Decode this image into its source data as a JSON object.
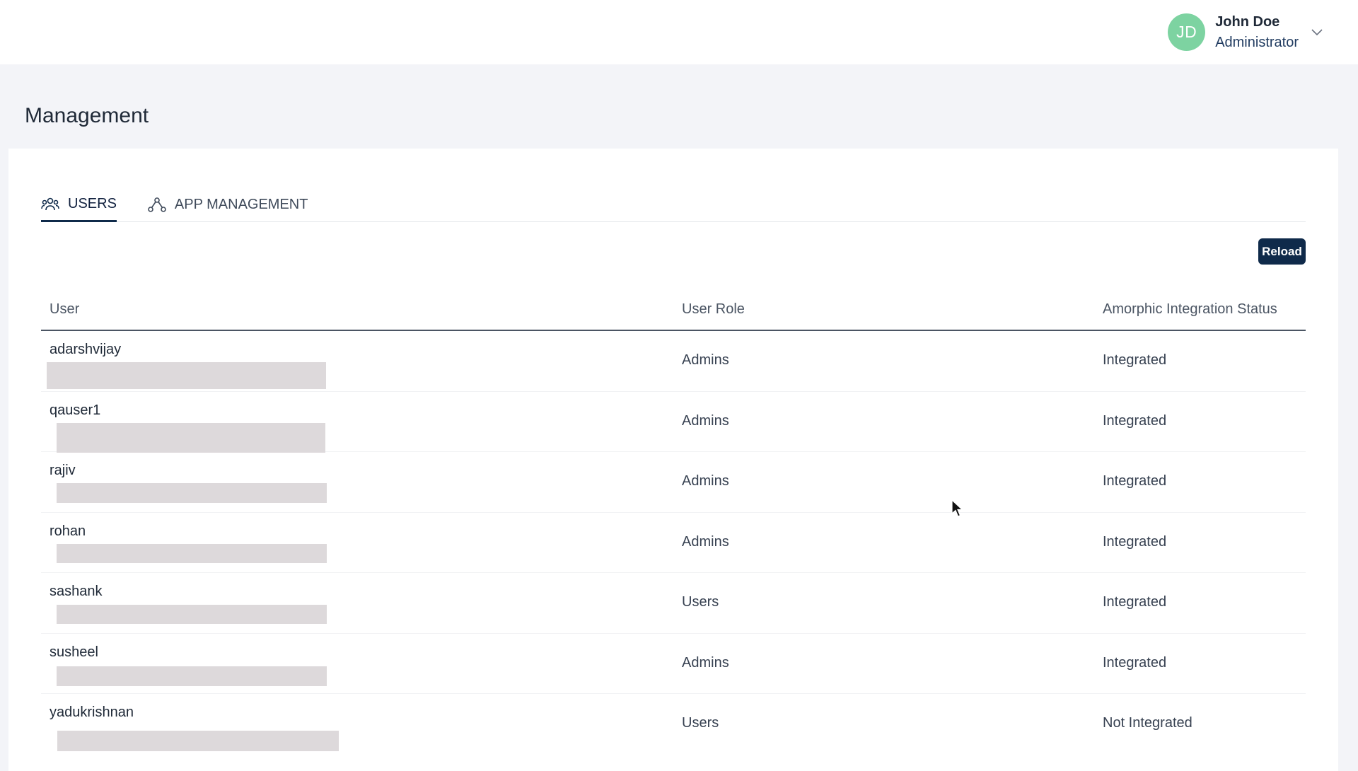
{
  "header": {
    "user": {
      "initials": "JD",
      "name": "John Doe",
      "role": "Administrator"
    }
  },
  "page": {
    "title": "Management"
  },
  "tabs": [
    {
      "label": "USERS",
      "icon": "users-icon",
      "active": true
    },
    {
      "label": "APP MANAGEMENT",
      "icon": "app-management-icon",
      "active": false
    }
  ],
  "toolbar": {
    "reload_label": "Reload"
  },
  "table": {
    "columns": [
      "User",
      "User Role",
      "Amorphic Integration Status"
    ],
    "rows": [
      {
        "user": "adarshvijay",
        "role": "Admins",
        "status": "Integrated"
      },
      {
        "user": "qauser1",
        "role": "Admins",
        "status": "Integrated"
      },
      {
        "user": "rajiv",
        "role": "Admins",
        "status": "Integrated"
      },
      {
        "user": "rohan",
        "role": "Admins",
        "status": "Integrated"
      },
      {
        "user": "sashank",
        "role": "Users",
        "status": "Integrated"
      },
      {
        "user": "susheel",
        "role": "Admins",
        "status": "Integrated"
      },
      {
        "user": "yadukrishnan",
        "role": "Users",
        "status": "Not Integrated"
      }
    ]
  },
  "colors": {
    "accent": "#0f2a4a",
    "avatar": "#7dd3a1",
    "redaction": "#ddd9db"
  }
}
